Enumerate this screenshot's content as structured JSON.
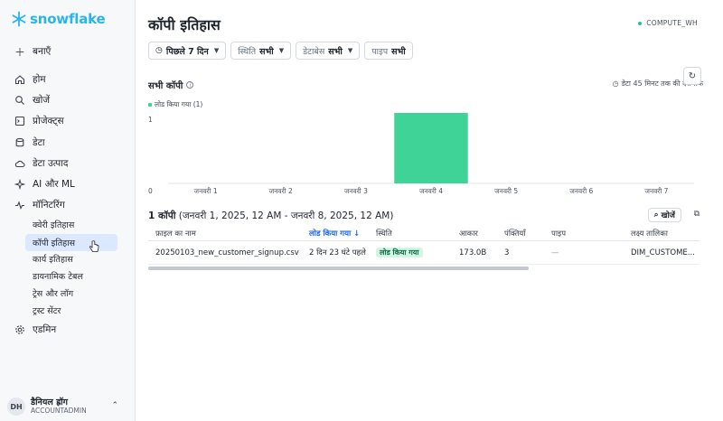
{
  "brand": {
    "name": "snowflake",
    "color": "#29b5e8"
  },
  "sidebar": {
    "create_label": "बनाएँ",
    "items": [
      {
        "label": "होम",
        "icon": "home-icon"
      },
      {
        "label": "खोजें",
        "icon": "search-icon"
      },
      {
        "label": "प्रोजेक्ट्स",
        "icon": "projects-icon"
      },
      {
        "label": "डेटा",
        "icon": "database-icon"
      },
      {
        "label": "डेटा उत्पाद",
        "icon": "cloud-icon"
      },
      {
        "label": "AI और ML",
        "icon": "sparkle-icon"
      },
      {
        "label": "मॉनिटरिंग",
        "icon": "activity-icon"
      }
    ],
    "sub_items": [
      {
        "label": "क्वेरी इतिहास",
        "active": false
      },
      {
        "label": "कॉपी इतिहास",
        "active": true
      },
      {
        "label": "कार्य इतिहास",
        "active": false
      },
      {
        "label": "डायनामिक टेबल",
        "active": false
      },
      {
        "label": "ट्रेस और लॉग",
        "active": false
      },
      {
        "label": "ट्रस्ट सेंटर",
        "active": false
      }
    ],
    "admin_label": "एडमिन",
    "user": {
      "initials": "DH",
      "name": "डैनियल ह्रॉग",
      "role": "ACCOUNTADMIN"
    }
  },
  "header": {
    "title": "कॉपी इतिहास",
    "warehouse": "COMPUTE_WH"
  },
  "filters": [
    {
      "label": "",
      "value": "पिछले 7 दिन",
      "icon": "clock-icon"
    },
    {
      "label": "स्थिति",
      "value": "सभी"
    },
    {
      "label": "डेटाबेस",
      "value": "सभी"
    },
    {
      "label": "पाइप",
      "value": "सभी"
    }
  ],
  "chart_section": {
    "title": "सभी कॉपी",
    "delay_note": "डेटा 45 मिनट तक की देरी तक"
  },
  "chart_data": {
    "type": "bar",
    "categories": [
      "जनवरी 1",
      "जनवरी 2",
      "जनवरी 3",
      "जनवरी 4",
      "जनवरी 5",
      "जनवरी 6",
      "जनवरी 7"
    ],
    "series": [
      {
        "name": "लोड किया गया (1)",
        "values": [
          0,
          0,
          0,
          1,
          0,
          0,
          0
        ]
      }
    ],
    "ylim": [
      0,
      1
    ],
    "y_ticks": [
      "0",
      "1"
    ],
    "bar_color": "#3fd397",
    "grid": false,
    "legend": "top-left"
  },
  "table_section": {
    "count": "1 कॉपी",
    "range": "(जनवरी 1, 2025, 12 AM - जनवरी 8, 2025, 12 AM)",
    "search_label": "खोजें",
    "columns": [
      "फ़ाइल का नाम",
      "लोड किया गया ↓",
      "स्थिति",
      "आकार",
      "पंक्तियाँ",
      "पाइप",
      "लक्ष्य तालिका"
    ],
    "rows": [
      {
        "file": "20250103_new_customer_signup.csv",
        "loaded": "2 दिन 23 घंटे पहले",
        "status": "लोड किया गया",
        "size": "173.0B",
        "rows": "3",
        "pipe": "—",
        "target": "DIM_CUSTOME..."
      }
    ],
    "horizontal_scroll_fraction": 0.69
  }
}
